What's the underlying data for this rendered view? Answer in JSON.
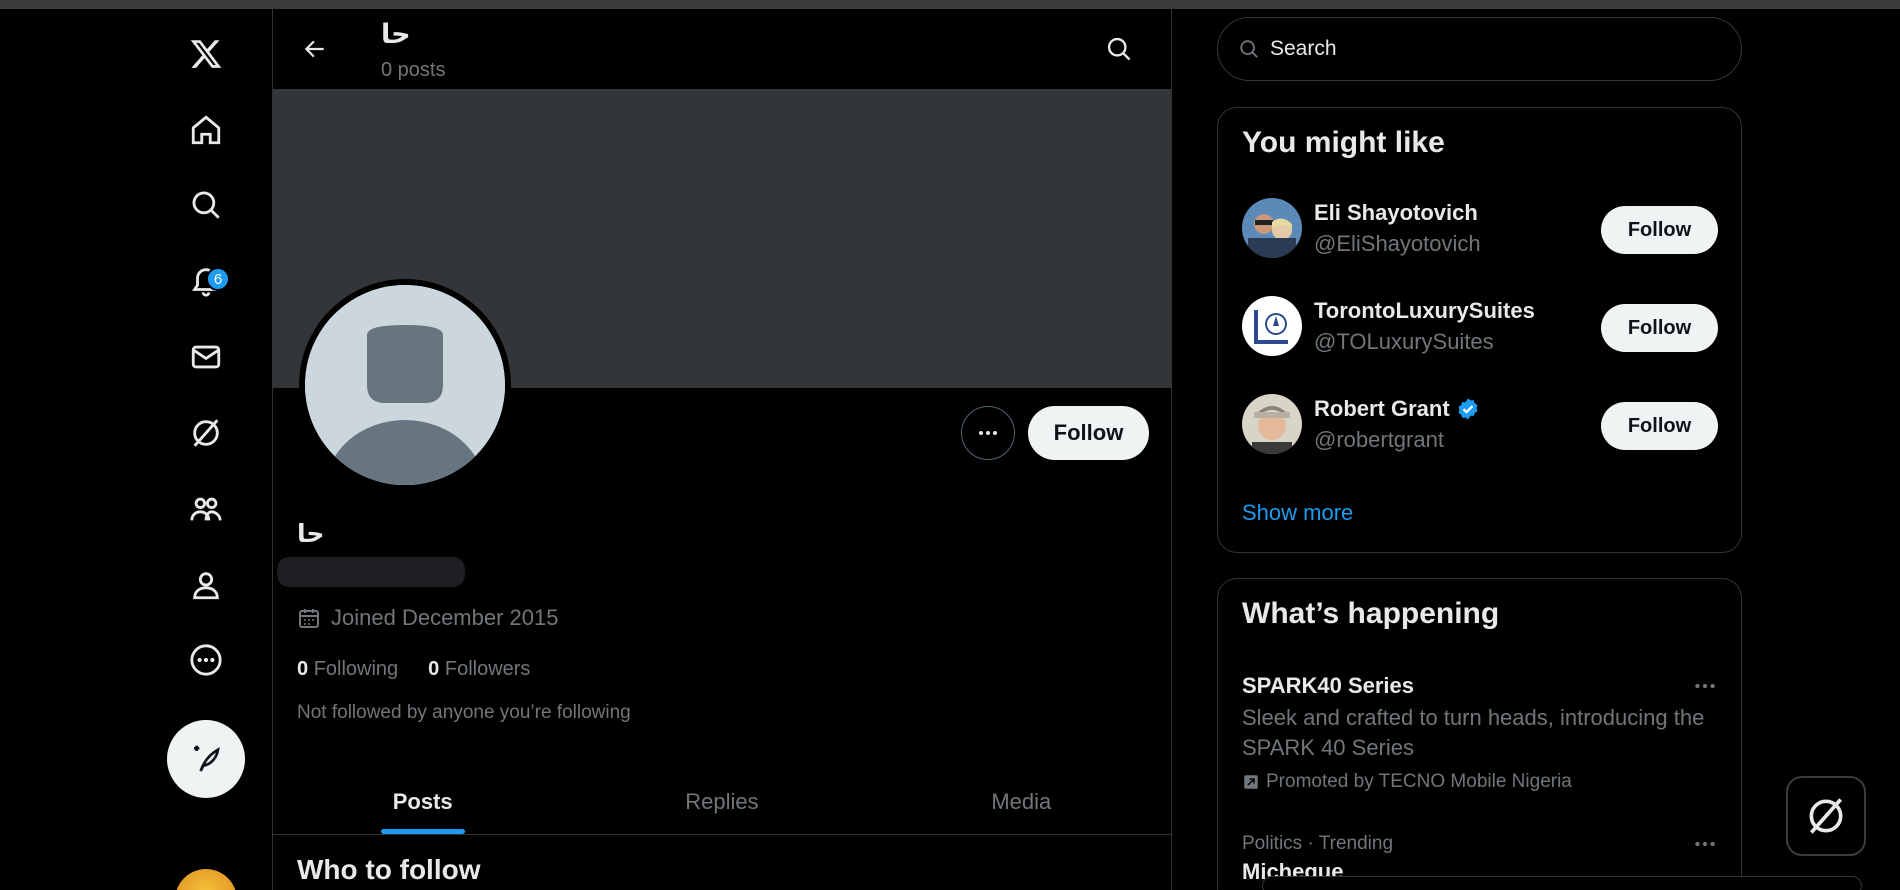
{
  "header": {
    "name": "حا",
    "posts": "0 posts"
  },
  "nav": {
    "notifications_count": "6",
    "icons": [
      "x-logo-icon",
      "home-icon",
      "explore-icon",
      "notifications-icon",
      "messages-icon",
      "grok-icon",
      "communities-icon",
      "profile-icon",
      "more-icon",
      "post-icon"
    ]
  },
  "profile": {
    "display_name": "حا",
    "joined": "Joined December 2015",
    "following_count": "0",
    "following_label": "Following",
    "followers_count": "0",
    "followers_label": "Followers",
    "not_followed": "Not followed by anyone you’re following",
    "follow_label": "Follow"
  },
  "tabs": [
    {
      "label": "Posts",
      "active": true
    },
    {
      "label": "Replies",
      "active": false
    },
    {
      "label": "Media",
      "active": false
    }
  ],
  "who_to_follow": "Who to follow",
  "search": {
    "placeholder": "Search"
  },
  "you_might_like": {
    "title": "You might like",
    "users": [
      {
        "name": "Eli Shayotovich",
        "handle": "@EliShayotovich",
        "verified": false,
        "follow": "Follow"
      },
      {
        "name": "TorontoLuxurySuites",
        "handle": "@TOLuxurySuites",
        "verified": false,
        "follow": "Follow"
      },
      {
        "name": "Robert Grant",
        "handle": "@robertgrant",
        "verified": true,
        "follow": "Follow"
      }
    ],
    "show_more": "Show more"
  },
  "whats_happening": {
    "title": "What’s happening",
    "trends": [
      {
        "title": "SPARK40 Series",
        "desc": "Sleek and crafted to turn heads, introducing the SPARK 40 Series",
        "promo": "Promoted by TECNO Mobile Nigeria"
      },
      {
        "meta": "Politics · Trending",
        "title": "Micheque"
      }
    ]
  },
  "colors": {
    "accent": "#1d9bf0",
    "background": "#000000",
    "banner": "#333639",
    "muted": "#71767b"
  }
}
